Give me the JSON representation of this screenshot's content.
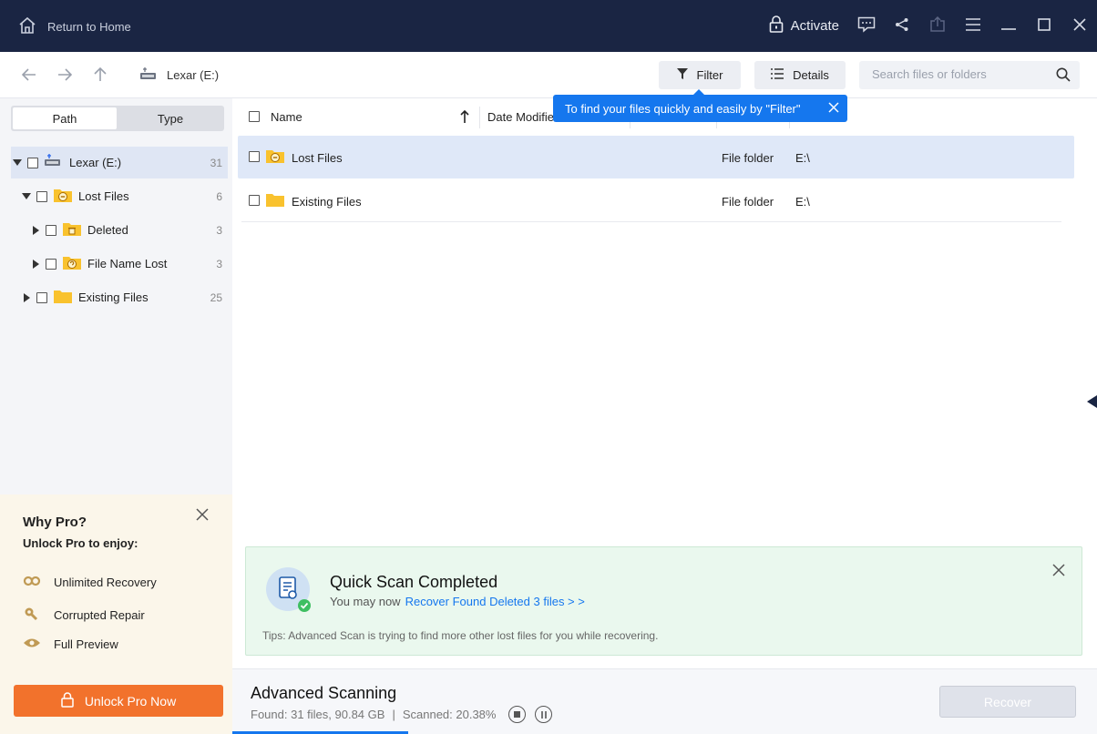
{
  "titlebar": {
    "home_label": "Return to Home",
    "activate_label": "Activate"
  },
  "toolbar": {
    "location": "Lexar (E:)",
    "filter_label": "Filter",
    "details_label": "Details",
    "search_placeholder": "Search files or folders"
  },
  "tooltip": {
    "text": "To find your files quickly and easily by \"Filter\""
  },
  "sidebar": {
    "tabs": [
      "Path",
      "Type"
    ],
    "tree": [
      {
        "label": "Lexar (E:)",
        "count": "31"
      },
      {
        "label": "Lost Files",
        "count": "6"
      },
      {
        "label": "Deleted",
        "count": "3"
      },
      {
        "label": "File Name Lost",
        "count": "3"
      },
      {
        "label": "Existing Files",
        "count": "25"
      }
    ]
  },
  "pro": {
    "title": "Why Pro?",
    "subtitle": "Unlock Pro to enjoy:",
    "features": [
      "Unlimited Recovery",
      "Corrupted Repair",
      "Full Preview"
    ],
    "button_label": "Unlock Pro Now"
  },
  "list": {
    "columns": [
      "Name",
      "Date Modifie"
    ],
    "rows": [
      {
        "name": "Lost Files",
        "type": "File folder",
        "path": "E:\\"
      },
      {
        "name": "Existing Files",
        "type": "File folder",
        "path": "E:\\"
      }
    ]
  },
  "notice": {
    "title": "Quick Scan Completed",
    "sub_prefix": "You may now",
    "sub_link": "Recover Found Deleted 3 files > >",
    "tips": "Tips: Advanced Scan is trying to find more other lost files for you while recovering."
  },
  "status": {
    "title": "Advanced Scanning",
    "found": "Found: 31 files, 90.84 GB",
    "divider": "|",
    "scanned": "Scanned: 20.38%",
    "scanned_fraction": 0.2038,
    "recover_label": "Recover"
  },
  "colors": {
    "titlebar": "#1a2543",
    "accent": "#1577ee",
    "pro_button": "#f2722c",
    "notice_bg": "#eaf8ee",
    "folder": "#f9c22e"
  }
}
